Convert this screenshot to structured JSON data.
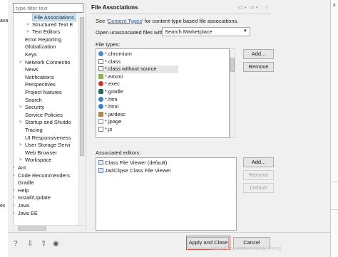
{
  "background": {
    "left_fragments": [
      "ava",
      "es"
    ],
    "right_fragments": [
      "x",
      "t"
    ]
  },
  "filter": {
    "placeholder": "type filter text"
  },
  "tree": [
    {
      "label": "File Associations",
      "depth": 2,
      "selected": true
    },
    {
      "label": "Structured Text E",
      "depth": 2,
      "expander": ">"
    },
    {
      "label": "Text Editors",
      "depth": 2,
      "expander": ">"
    },
    {
      "label": "Error Reporting",
      "depth": 1
    },
    {
      "label": "Globalization",
      "depth": 1
    },
    {
      "label": "Keys",
      "depth": 1
    },
    {
      "label": "Network Connectio",
      "depth": 1,
      "expander": ">"
    },
    {
      "label": "News",
      "depth": 1
    },
    {
      "label": "Notifications",
      "depth": 1
    },
    {
      "label": "Perspectives",
      "depth": 1
    },
    {
      "label": "Project Natures",
      "depth": 1
    },
    {
      "label": "Search",
      "depth": 1
    },
    {
      "label": "Security",
      "depth": 1,
      "expander": ">"
    },
    {
      "label": "Service Policies",
      "depth": 1
    },
    {
      "label": "Startup and Shutdo",
      "depth": 1,
      "expander": ">"
    },
    {
      "label": "Tracing",
      "depth": 1
    },
    {
      "label": "UI Responsiveness",
      "depth": 1
    },
    {
      "label": "User Storage Servi",
      "depth": 1,
      "expander": ">"
    },
    {
      "label": "Web Browser",
      "depth": 1
    },
    {
      "label": "Workspace",
      "depth": 1,
      "expander": ">"
    },
    {
      "label": "Ant",
      "depth": 0,
      "expander": ">"
    },
    {
      "label": "Code Recommenders",
      "depth": 0,
      "expander": ">"
    },
    {
      "label": "Gradle",
      "depth": 0
    },
    {
      "label": "Help",
      "depth": 0,
      "expander": ">"
    },
    {
      "label": "Install/Update",
      "depth": 0,
      "expander": ">"
    },
    {
      "label": "Java",
      "depth": 0,
      "expander": ">"
    },
    {
      "label": "Java EE",
      "depth": 0,
      "expander": ">"
    }
  ],
  "page": {
    "title": "File Associations",
    "see_prefix": "See '",
    "see_link": "Content Types",
    "see_suffix": "' for content-type based file associations.",
    "open_label": "Open unassociated files with:",
    "open_value": "Search Marketplace",
    "file_types_label": "File types:",
    "file_types": [
      {
        "name": "*.chromium",
        "icon": "browser-icon"
      },
      {
        "name": "*.class",
        "icon": "class-file-icon"
      },
      {
        "name": "*.class without source",
        "icon": "class-file-icon",
        "selected": true
      },
      {
        "name": "*.e4xmi",
        "icon": "model-icon"
      },
      {
        "name": "*.exec",
        "icon": "coverage-icon"
      },
      {
        "name": "*.gradle",
        "icon": "gradle-icon"
      },
      {
        "name": "*.htm",
        "icon": "globe-icon"
      },
      {
        "name": "*.html",
        "icon": "globe-icon"
      },
      {
        "name": "*.jardesc",
        "icon": "jar-icon"
      },
      {
        "name": "*.jpage",
        "icon": "page-icon"
      },
      {
        "name": "*.js",
        "icon": "script-icon"
      }
    ],
    "file_type_buttons": {
      "add": "Add...",
      "remove": "Remove"
    },
    "editors_label": "Associated editors:",
    "editors": [
      {
        "name": "Class File Viewer (default)",
        "icon": "viewer-icon"
      },
      {
        "name": "JadClipse Class File Viewer",
        "icon": "viewer-icon"
      }
    ],
    "editor_buttons": {
      "add": "Add...",
      "remove": "Remove",
      "default": "Default"
    }
  },
  "footer": {
    "apply_close": "Apply and Close",
    "cancel": "Cancel",
    "watermark": "https://blog.csdn.net/jing_xifeng"
  },
  "colors": {
    "accent_link": "#1a5fb4",
    "highlight": "#d9534f",
    "selection": "#cce4f7"
  }
}
